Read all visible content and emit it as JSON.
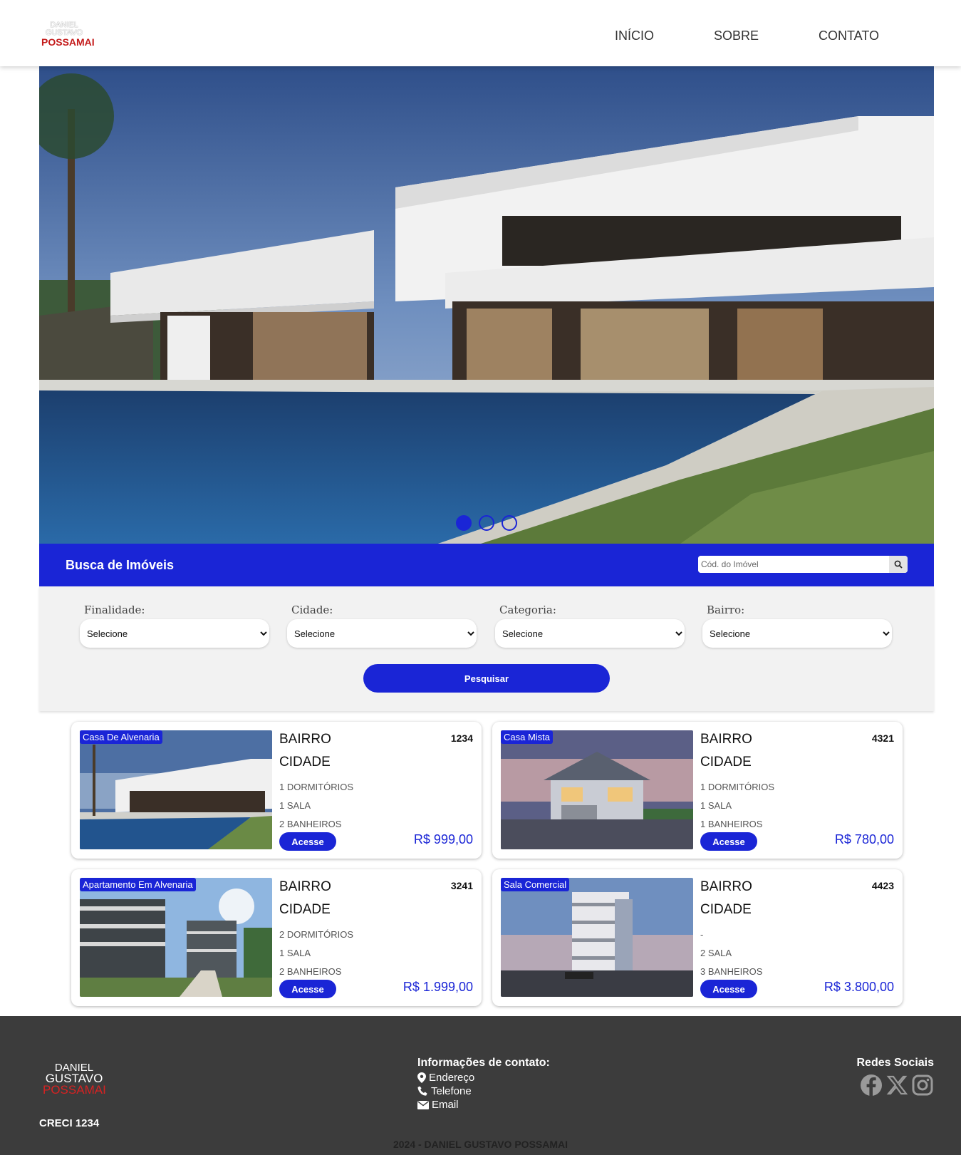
{
  "brand": {
    "logo_line1": "DANIEL",
    "logo_line2": "GUSTAVO",
    "logo_line3": "POSSAMAI"
  },
  "nav": {
    "items": [
      {
        "label": "INÍCIO"
      },
      {
        "label": "SOBRE"
      },
      {
        "label": "CONTATO"
      }
    ]
  },
  "carousel": {
    "slides": 3,
    "active": 1
  },
  "search": {
    "title": "Busca de Imóveis",
    "code_placeholder": "Cód. do Imóvel",
    "filters": [
      {
        "label": "Finalidade:",
        "value": "Selecione"
      },
      {
        "label": "Cidade:",
        "value": "Selecione"
      },
      {
        "label": "Categoria:",
        "value": "Selecione"
      },
      {
        "label": "Bairro:",
        "value": "Selecione"
      }
    ],
    "button": "Pesquisar"
  },
  "listings": [
    {
      "category": "Casa De Alvenaria",
      "bairro": "BAIRRO",
      "cidade": "CIDADE",
      "code": "1234",
      "dorms": "1 DORMITÓRIOS",
      "salas": "1 SALA",
      "banheiros": "2 BANHEIROS",
      "button": "Acesse",
      "price": "R$ 999,00"
    },
    {
      "category": "Casa Mista",
      "bairro": "BAIRRO",
      "cidade": "CIDADE",
      "code": "4321",
      "dorms": "1 DORMITÓRIOS",
      "salas": "1 SALA",
      "banheiros": "1 BANHEIROS",
      "button": "Acesse",
      "price": "R$ 780,00"
    },
    {
      "category": "Apartamento Em Alvenaria",
      "bairro": "BAIRRO",
      "cidade": "CIDADE",
      "code": "3241",
      "dorms": "2 DORMITÓRIOS",
      "salas": "1 SALA",
      "banheiros": "2 BANHEIROS",
      "button": "Acesse",
      "price": "R$ 1.999,00"
    },
    {
      "category": "Sala Comercial",
      "bairro": "BAIRRO",
      "cidade": "CIDADE",
      "code": "4423",
      "dorms": "-",
      "salas": "2 SALA",
      "banheiros": "3 BANHEIROS",
      "button": "Acesse",
      "price": "R$ 3.800,00"
    }
  ],
  "footer": {
    "logo_line1": "DANIEL",
    "logo_line2": "GUSTAVO",
    "logo_line3": "POSSAMAI",
    "creci": "CRECI 1234",
    "contact_title": "Informações de contato:",
    "address": "Endereço",
    "phone": "Telefone",
    "email": "Email",
    "social_title": "Redes Sociais",
    "social_icons": [
      "facebook-icon",
      "x-icon",
      "instagram-icon"
    ],
    "copyright": "2024 - DANIEL GUSTAVO POSSAMAI"
  },
  "colors": {
    "accent": "#1a25d6",
    "footer_bg": "#3c3c3c",
    "brand_red": "#c41b1b"
  }
}
